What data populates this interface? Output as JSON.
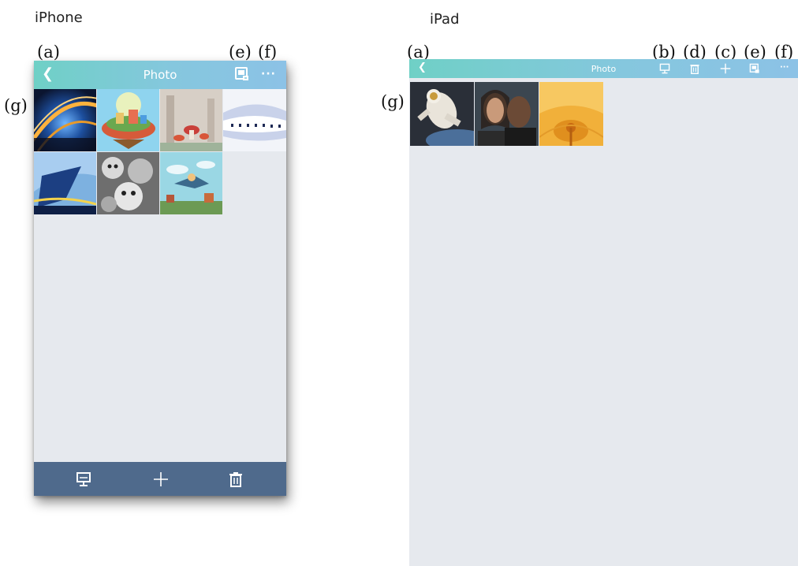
{
  "labels": {
    "iphone": "iPhone",
    "ipad": "iPad"
  },
  "callouts": {
    "a": "(a)",
    "b": "(b)",
    "c": "(c)",
    "d": "(d)",
    "e": "(e)",
    "f": "(f)",
    "g": "(g)"
  },
  "screen": {
    "title": "Photo",
    "back_glyph": "❮",
    "more_glyph": "···"
  },
  "icons": {
    "back": "back-chevron-icon",
    "slideshow": "slideshow-icon",
    "add": "plus-icon",
    "delete": "trash-icon",
    "export": "export-icon",
    "more": "more-icon"
  },
  "colors": {
    "navbar_start": "#6fd0c6",
    "navbar_end": "#8cc2e6",
    "toolbar": "#4f6a8c",
    "background": "#e6e9ee"
  },
  "iphone_photos": [
    "tunnel-lights-photo",
    "floating-island-photo",
    "mushroom-fantasy-photo",
    "white-building-photo",
    "blue-architecture-photo",
    "cartoon-creatures-photo",
    "flying-character-photo"
  ],
  "ipad_photos": [
    "astronaut-photo",
    "actors-portrait-photo",
    "orange-flower-photo"
  ]
}
